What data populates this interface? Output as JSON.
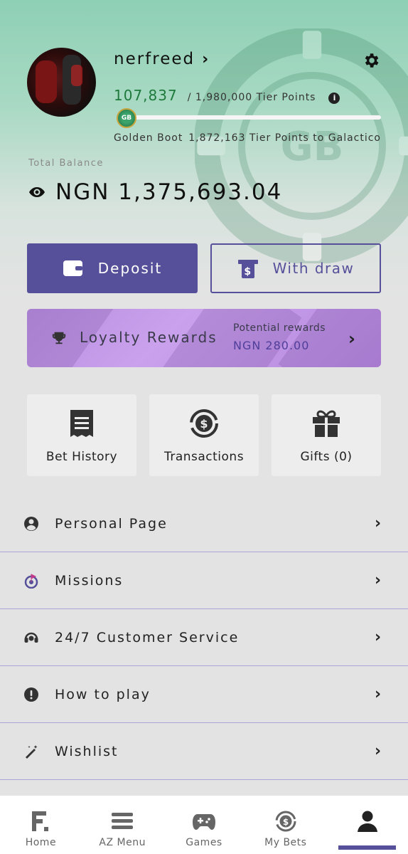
{
  "profile": {
    "username": "nerfreed",
    "tier_points": "107,837",
    "tier_total": "/ 1,980,000 Tier Points",
    "progress_fraction": 0.0545,
    "current_tier": "Golden Boot",
    "next_tier_text": "1,872,163 Tier Points to Galactico",
    "badge_text": "GB"
  },
  "balance": {
    "label": "Total Balance",
    "value": "NGN 1,375,693.04"
  },
  "actions": {
    "deposit": "Deposit",
    "withdraw": "With draw"
  },
  "loyalty": {
    "title": "Loyalty Rewards",
    "potential_label": "Potential rewards",
    "potential_value": "NGN 280.00"
  },
  "tiles": [
    {
      "label": "Bet History",
      "icon": "receipt-icon"
    },
    {
      "label": "Transactions",
      "icon": "dollar-cycle-icon"
    },
    {
      "label": "Gifts (0)",
      "icon": "gift-icon"
    }
  ],
  "menu": [
    {
      "label": "Personal Page",
      "icon": "user-circle-icon"
    },
    {
      "label": "Missions",
      "icon": "target-flag-icon"
    },
    {
      "label": "24/7 Customer Service",
      "icon": "headset-icon"
    },
    {
      "label": "How to play",
      "icon": "exclamation-circle-icon"
    },
    {
      "label": "Wishlist",
      "icon": "magic-wand-icon"
    }
  ],
  "nav": [
    {
      "label": "Home",
      "icon": "home-logo-icon"
    },
    {
      "label": "AZ Menu",
      "icon": "hamburger-icon"
    },
    {
      "label": "Games",
      "icon": "gamepad-icon"
    },
    {
      "label": "My Bets",
      "icon": "dollar-cycle-icon"
    },
    {
      "label": "",
      "icon": "profile-icon",
      "active": true
    }
  ],
  "colors": {
    "accent": "#56509a",
    "tier_green": "#1e7a3c",
    "hero_top": "#8ed0b5"
  }
}
